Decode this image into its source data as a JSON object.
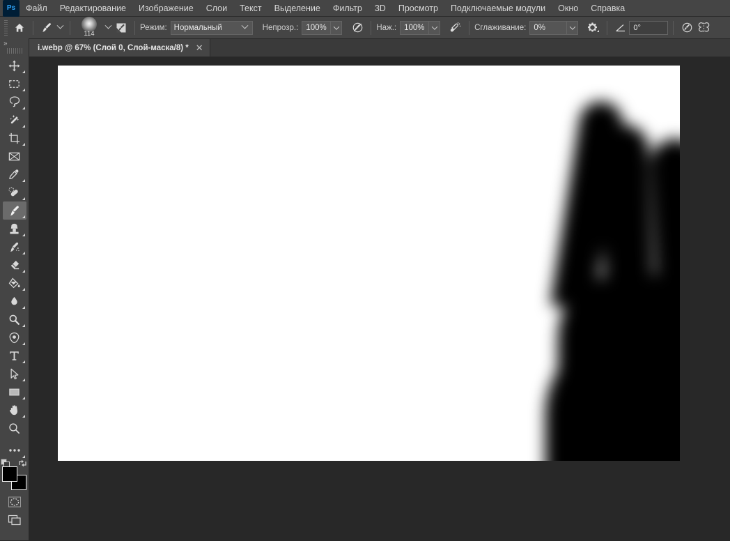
{
  "app": {
    "name": "Adobe Photoshop",
    "logo_text": "Ps"
  },
  "menubar": {
    "items": [
      {
        "label": "Файл"
      },
      {
        "label": "Редактирование"
      },
      {
        "label": "Изображение"
      },
      {
        "label": "Слои"
      },
      {
        "label": "Текст"
      },
      {
        "label": "Выделение"
      },
      {
        "label": "Фильтр"
      },
      {
        "label": "3D"
      },
      {
        "label": "Просмотр"
      },
      {
        "label": "Подключаемые модули"
      },
      {
        "label": "Окно"
      },
      {
        "label": "Справка"
      }
    ]
  },
  "options_bar": {
    "home_icon": "home-icon",
    "tool_preset_icon": "brush-tool-icon",
    "brush_size": "114",
    "brush_preview_icon": "soft-round-brush-preview",
    "brush_settings_panel_icon": "brush-settings-panel-icon",
    "mode_label": "Режим:",
    "mode_value": "Нормальный",
    "opacity_label": "Непрозр.:",
    "opacity_value": "100%",
    "opacity_pressure_icon": "pressure-opacity-icon",
    "flow_label": "Наж.:",
    "flow_value": "100%",
    "airbrush_icon": "airbrush-icon",
    "smoothing_label": "Сглаживание:",
    "smoothing_value": "0%",
    "smoothing_options_icon": "gear-icon",
    "angle_icon": "brush-angle-icon",
    "angle_value": "0°",
    "tablet_pressure_icon": "tablet-pressure-size-icon",
    "symmetry_icon": "symmetry-butterfly-icon"
  },
  "tabbar": {
    "collapse_label": "»",
    "document_title": "i.webp @ 67% (Слой 0, Слой-маска/8) *",
    "close_label": "✕"
  },
  "toolbar": {
    "collapse_label": "»",
    "groups": [
      [
        {
          "name": "move-tool",
          "icon": "move-icon",
          "has_submenu": true,
          "active": false
        },
        {
          "name": "rectangular-marquee-tool",
          "icon": "marquee-icon",
          "has_submenu": true,
          "active": false
        },
        {
          "name": "lasso-tool",
          "icon": "lasso-icon",
          "has_submenu": true,
          "active": false
        },
        {
          "name": "magic-wand-tool",
          "icon": "magic-wand-icon",
          "has_submenu": true,
          "active": false
        },
        {
          "name": "crop-tool",
          "icon": "crop-icon",
          "has_submenu": true,
          "active": false
        },
        {
          "name": "frame-tool",
          "icon": "frame-icon",
          "has_submenu": false,
          "active": false
        },
        {
          "name": "eyedropper-tool",
          "icon": "eyedropper-icon",
          "has_submenu": true,
          "active": false
        },
        {
          "name": "healing-brush-tool",
          "icon": "healing-brush-icon",
          "has_submenu": true,
          "active": false
        },
        {
          "name": "brush-tool",
          "icon": "brush-icon",
          "has_submenu": true,
          "active": true
        },
        {
          "name": "clone-stamp-tool",
          "icon": "clone-stamp-icon",
          "has_submenu": true,
          "active": false
        },
        {
          "name": "history-brush-tool",
          "icon": "history-brush-icon",
          "has_submenu": true,
          "active": false
        },
        {
          "name": "eraser-tool",
          "icon": "eraser-icon",
          "has_submenu": true,
          "active": false
        },
        {
          "name": "gradient-tool",
          "icon": "paint-bucket-icon",
          "has_submenu": true,
          "active": false
        },
        {
          "name": "blur-tool",
          "icon": "blur-drop-icon",
          "has_submenu": true,
          "active": false
        },
        {
          "name": "dodge-tool",
          "icon": "dodge-icon",
          "has_submenu": true,
          "active": false
        },
        {
          "name": "pen-tool",
          "icon": "pen-icon",
          "has_submenu": true,
          "active": false
        },
        {
          "name": "type-tool",
          "icon": "type-icon",
          "has_submenu": true,
          "active": false
        },
        {
          "name": "path-selection-tool",
          "icon": "path-arrow-icon",
          "has_submenu": true,
          "active": false
        },
        {
          "name": "rectangle-tool",
          "icon": "rectangle-shape-icon",
          "has_submenu": true,
          "active": false
        },
        {
          "name": "hand-tool",
          "icon": "hand-icon",
          "has_submenu": true,
          "active": false
        },
        {
          "name": "zoom-tool",
          "icon": "magnifier-icon",
          "has_submenu": false,
          "active": false
        },
        {
          "name": "edit-toolbar",
          "icon": "ellipsis-icon",
          "has_submenu": true,
          "active": false
        }
      ]
    ],
    "default_colors_icon": "default-colors-icon",
    "switch_colors_icon": "switch-colors-icon",
    "foreground_color": "#000000",
    "background_color": "#000000",
    "quick_mask_icon": "quick-mask-icon",
    "screen_mode_icon": "screen-mode-icon"
  },
  "canvas": {
    "background_color": "#282828",
    "document_background": "#ffffff",
    "artwork_description": "blurred black layer-mask silhouette of fingers at right edge"
  }
}
